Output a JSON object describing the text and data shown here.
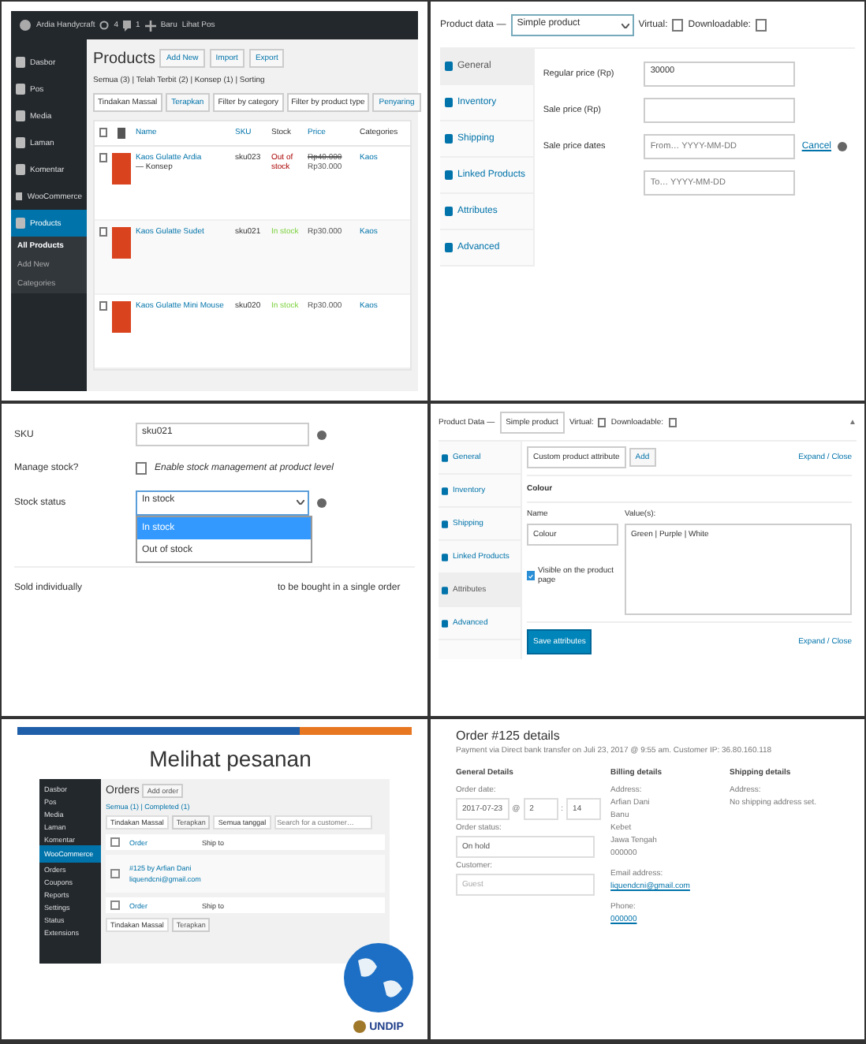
{
  "products_panel": {
    "top_bar": {
      "site": "Ardia Handycraft",
      "updates": "4",
      "comments": "1",
      "new": "Baru",
      "view": "Lihat Pos"
    },
    "sidebar": [
      {
        "label": "Dasbor",
        "kind": "menu",
        "selected": false
      },
      {
        "label": "Pos",
        "kind": "menu",
        "selected": false
      },
      {
        "label": "Media",
        "kind": "menu",
        "selected": false
      },
      {
        "label": "Laman",
        "kind": "menu",
        "selected": false
      },
      {
        "label": "Komentar",
        "kind": "menu",
        "selected": false
      },
      {
        "label": "WooCommerce",
        "kind": "menu",
        "selected": false
      },
      {
        "label": "Products",
        "kind": "menu",
        "selected": true
      },
      {
        "label": "All Products",
        "kind": "sub",
        "selected": true
      },
      {
        "label": "Add New",
        "kind": "sub",
        "selected": false
      },
      {
        "label": "Categories",
        "kind": "sub",
        "selected": false
      }
    ],
    "heading": "Products",
    "header_buttons": [
      "Add New",
      "Import",
      "Export"
    ],
    "views": "Semua (3) | Telah Terbit (2) | Konsep (1) | Sorting",
    "bulk_action": "Tindakan Massal",
    "apply": "Terapkan",
    "filters": [
      "Filter by category",
      "Filter by product type"
    ],
    "filter_button": "Penyaring",
    "select_all_checked": false,
    "columns": [
      "Name",
      "SKU",
      "Stock",
      "Price",
      "Categories"
    ],
    "rows": [
      {
        "name": "Kaos Gulatte Ardia",
        "status": "— Konsep",
        "sku": "sku023",
        "stock": "Out of stock",
        "in_stock": false,
        "prices": [
          "Rp40.000",
          "Rp30.000"
        ],
        "category": "Kaos",
        "checked": false
      },
      {
        "name": "Kaos Gulatte Sudet",
        "status": "",
        "sku": "sku021",
        "stock": "In stock",
        "in_stock": true,
        "prices": [
          "Rp30.000"
        ],
        "category": "Kaos",
        "checked": false
      },
      {
        "name": "Kaos Gulatte Mini Mouse",
        "status": "",
        "sku": "sku020",
        "stock": "In stock",
        "in_stock": true,
        "prices": [
          "Rp30.000"
        ],
        "category": "Kaos",
        "checked": false
      }
    ]
  },
  "general_panel": {
    "label": "Product data —",
    "type": "Simple product",
    "options": [
      {
        "label": "Virtual:",
        "checked": false
      },
      {
        "label": "Downloadable:",
        "checked": false
      }
    ],
    "tabs": [
      {
        "label": "General",
        "selected": true
      },
      {
        "label": "Inventory",
        "selected": false
      },
      {
        "label": "Shipping",
        "selected": false
      },
      {
        "label": "Linked Products",
        "selected": false
      },
      {
        "label": "Attributes",
        "selected": false
      },
      {
        "label": "Advanced",
        "selected": false
      }
    ],
    "regular_price": {
      "label": "Regular price (Rp)",
      "value": "30000"
    },
    "sale_price": {
      "label": "Sale price (Rp)"
    },
    "sale_dates": {
      "label": "Sale price dates",
      "from_placeholder": "From… YYYY-MM-DD",
      "to_placeholder": "To… YYYY-MM-DD",
      "cancel": "Cancel"
    }
  },
  "inventory_panel": {
    "sku": {
      "label": "SKU",
      "value": "sku021"
    },
    "manage_stock": {
      "label": "Manage stock?",
      "text": "Enable stock management at product level",
      "checked": false
    },
    "stock_status": {
      "label": "Stock status",
      "value": "In stock",
      "options": [
        {
          "label": "In stock",
          "selected": true
        },
        {
          "label": "Out of stock",
          "selected": false
        }
      ]
    },
    "sold_individually": {
      "label": "Sold individually",
      "text": "to be bought in a single order"
    }
  },
  "attributes_panel": {
    "label": "Product Data —",
    "type": "Simple product",
    "options": [
      {
        "label": "Virtual:",
        "checked": false
      },
      {
        "label": "Downloadable:",
        "checked": false
      }
    ],
    "collapse": "▲",
    "tabs": [
      {
        "label": "General",
        "selected": false
      },
      {
        "label": "Inventory",
        "selected": false
      },
      {
        "label": "Shipping",
        "selected": false
      },
      {
        "label": "Linked Products",
        "selected": false
      },
      {
        "label": "Attributes",
        "selected": true
      },
      {
        "label": "Advanced",
        "selected": false
      }
    ],
    "attribute_select": "Custom product attribute",
    "add": "Add",
    "expand_close": "Expand / Close",
    "attribute_title": "Colour",
    "name_label": "Name",
    "values_label": "Value(s):",
    "name": "Colour",
    "values": "Green | Purple | White",
    "visible": {
      "label": "Visible on the product page",
      "checked": true
    },
    "save": "Save attributes",
    "expand_close_bottom": "Expand / Close"
  },
  "slide_panel": {
    "title": "Melihat pesanan",
    "sidebar": [
      {
        "label": "Dasbor",
        "selected": false
      },
      {
        "label": "Pos",
        "selected": false
      },
      {
        "label": "Media",
        "selected": false
      },
      {
        "label": "Laman",
        "selected": false
      },
      {
        "label": "Komentar",
        "selected": false
      },
      {
        "label": "WooCommerce",
        "selected": true
      },
      {
        "label": "Orders",
        "selected": false
      },
      {
        "label": "Coupons",
        "selected": false
      },
      {
        "label": "Reports",
        "selected": false
      },
      {
        "label": "Settings",
        "selected": false
      },
      {
        "label": "Status",
        "selected": false
      },
      {
        "label": "Extensions",
        "selected": false
      }
    ],
    "heading": "Orders",
    "add": "Add order",
    "views": "Semua (1) | Completed (1)",
    "bulk_action": "Tindakan Massal",
    "apply": "Terapkan",
    "dates": "Semua tanggal",
    "search_placeholder": "Search for a customer…",
    "header_checked": false,
    "columns": [
      "Order",
      "Ship to"
    ],
    "order_checked": false,
    "order": "#125 by Arfian Dani",
    "email": "liquendcni@gmail.com",
    "footer_checked": false,
    "footer_columns": [
      "Order",
      "Ship to"
    ],
    "bulk_action_bottom": "Tindakan Massal",
    "apply_bottom": "Terapkan",
    "logo": "UNDIP"
  },
  "order_panel": {
    "title": "Order #125 details",
    "subtitle": "Payment via Direct bank transfer on Juli 23, 2017 @ 9:55 am. Customer IP: 36.80.160.118",
    "general": {
      "title": "General Details",
      "date_label": "Order date:",
      "date": "2017-07-23",
      "hour": "2",
      "minute": "14",
      "at": "@",
      "colon": ":",
      "status_label": "Order status:",
      "status": "On hold",
      "customer_label": "Customer:",
      "customer": "Guest"
    },
    "billing": {
      "title": "Billing details",
      "address_label": "Address:",
      "address": [
        "Arfian Dani",
        "Banu",
        "Kebet",
        "Jawa Tengah",
        "000000"
      ],
      "email_label": "Email address:",
      "email": "liquendcni@gmail.com",
      "phone_label": "Phone:",
      "phone": "000000"
    },
    "shipping": {
      "title": "Shipping details",
      "address_label": "Address:",
      "address": "No shipping address set."
    }
  }
}
